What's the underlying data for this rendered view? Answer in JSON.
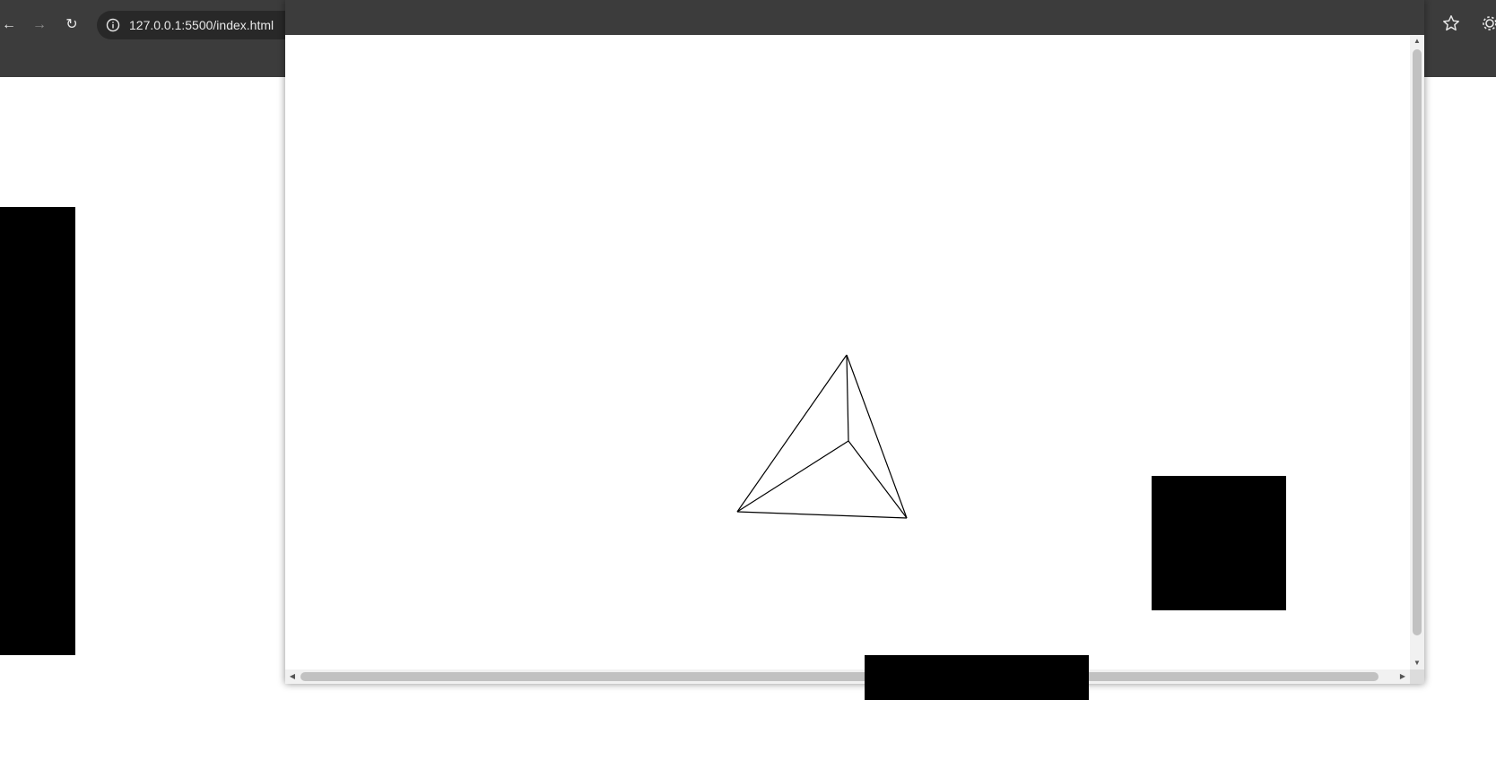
{
  "browser": {
    "url": "127.0.0.1:5500/index.html",
    "back_icon": "arrow-left-icon",
    "forward_icon": "arrow-right-icon",
    "reload_icon": "reload-icon",
    "site_info_icon": "info-icon",
    "bookmark_icon": "star-icon",
    "extension_icon": "gear-icon"
  },
  "colors": {
    "toolbar": "#3c3c3c",
    "omnibox": "#282828",
    "canvas_bg": "#ffffff",
    "shape_fill": "#000000",
    "wireframe_stroke": "#000000"
  },
  "popup": {
    "scene": "wireframe-tetrahedron"
  }
}
